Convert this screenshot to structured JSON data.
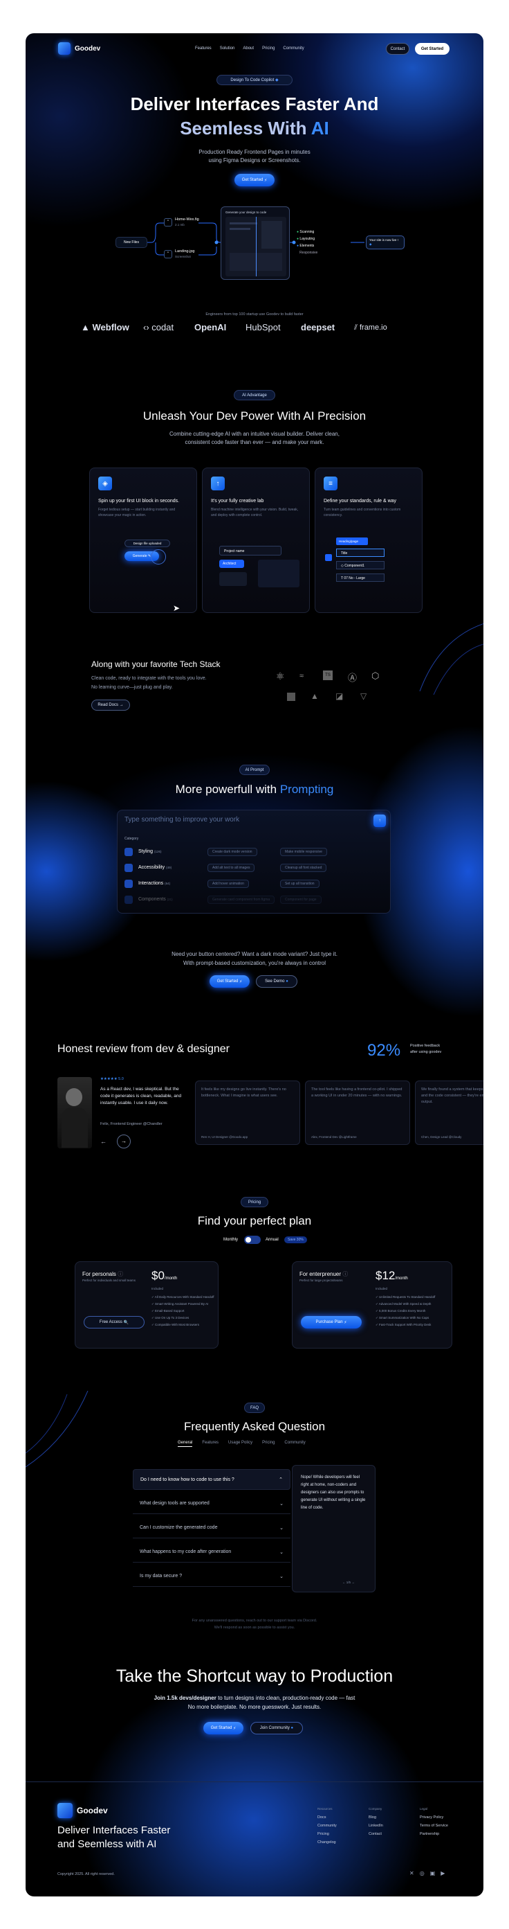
{
  "brand": {
    "name": "Goodev",
    "accent": "#1c62ff"
  },
  "nav": {
    "links": [
      "Features",
      "Solution",
      "About",
      "Pricing",
      "Community"
    ],
    "contact": "Contact",
    "get_started": "Get Started"
  },
  "hero": {
    "badge": "Design To Code Copilot",
    "title_line1": "Deliver Interfaces Faster And",
    "title_line2a": "Seemless With ",
    "title_line2b": "AI",
    "subtitle_line1": "Production Ready Frontend Pages in minutes",
    "subtitle_line2": "using Figma Designs or Screenshots.",
    "cta": "Get Started"
  },
  "flow": {
    "new_files": "New Files",
    "file1": "Home-Wex.fig",
    "file1_size": "2.1 mb",
    "file2": "Landing.jpg",
    "file2_size": "Screenshot",
    "generate": "Generate your design to code",
    "steps": [
      "Scanning",
      "Layouting",
      "Elements",
      "Responsive"
    ],
    "ready": "Your site is now live !"
  },
  "trusted": {
    "caption": "Engineers from top 100 startup use Goodev to build faster",
    "logos": [
      "Webflow",
      "codat",
      "OpenAI",
      "HubSpot",
      "deepset",
      "frame.io"
    ]
  },
  "advantage": {
    "badge": "AI Advantage",
    "title": "Unleash Your Dev Power With AI Precision",
    "sub1": "Combine cutting-edge AI with an intuitive visual builder. Deliver clean,",
    "sub2": "consistent code faster than ever — and make your mark.",
    "cards": [
      {
        "title": "Spin up your first UI block in seconds.",
        "desc": "Forget tedious setup — start building instantly and showcase your magic in action.",
        "btn1": "Design file uploaded",
        "btn2": "Generate"
      },
      {
        "title": "It's your fully creative lab",
        "desc": "Blend machine intelligence with your vision. Build, tweak, and deploy with complete control.",
        "row1": "Project name",
        "row2": "Architect"
      },
      {
        "title": "Define your standards, rule & way",
        "desc": "Turn team guidelines and conventions into custom consistency.",
        "tag": "Heading/page",
        "item1": "Title",
        "item2": "Component1",
        "item3": "07 No - Large"
      }
    ]
  },
  "stack": {
    "title": "Along with your favorite Tech Stack",
    "desc1": "Clean code, ready to integrate with the tools you love.",
    "desc2": "No learning curve—just plug and play.",
    "cta": "Read Docs",
    "icons": [
      "react-icon",
      "tailwind-icon",
      "typescript-icon",
      "angular-icon",
      "css-icon",
      "next-icon",
      "vite-icon",
      "vue-icon",
      "nuxt-icon"
    ]
  },
  "prompting": {
    "badge": "AI Prompt",
    "title_a": "More  powerfull with ",
    "title_b": "Prompting",
    "placeholder": "Type something to improve your work",
    "category": "Category",
    "rows": [
      {
        "label": "Styling",
        "count": "(126)",
        "c1": "Create dark mode version",
        "c2": "Make mobile responsive"
      },
      {
        "label": "Accessibility",
        "count": "(49)",
        "c1": "Add alt text to all images",
        "c2": "Cleanup all font stacked"
      },
      {
        "label": "Interactions",
        "count": "(64)",
        "c1": "Add hover animation",
        "c2": "Set up all transition"
      },
      {
        "label": "Components",
        "count": "(21)",
        "c1": "Generate card component from figma",
        "c2": "Component for page"
      }
    ],
    "sub1": "Need your button centered? Want a dark mode variant? Just type it.",
    "sub2": "With prompt-based customization, you're always in control",
    "cta1": "Get Started",
    "cta2": "See Demo"
  },
  "reviews": {
    "title": "Honest review from dev & ",
    "title_b": "designer",
    "stat": "92%",
    "stat_label1": "Positive feedback",
    "stat_label2": "after using goodev",
    "stars": "★★★★★ 5.0",
    "main": {
      "text": "As a React dev, I was skeptical. But the code it generates is clean, readable, and instantly usable. I use it daily now.",
      "author": "Felix, Frontend Engineer @Chandler"
    },
    "items": [
      {
        "text": "It feels like my designs go live instantly. There's no bottleneck. What I imagine is what users see.",
        "author": "Ren H, UI Designer @Goodo.app"
      },
      {
        "text": "The tool feels like having a frontend co-pilot. I shipped a working UI in under 20 minutes — with no warnings.",
        "author": "Alex, Frontend Dev @Lightframe"
      },
      {
        "text": "We finally found a system that keeps design guidelines and the code consistent — they're embedded in every output.",
        "author": "Chen, Design Lead @Cloudy"
      }
    ]
  },
  "pricing": {
    "badge": "Pricing",
    "title": "Find your perfect plan",
    "monthly": "Monthly",
    "annual": "Annual",
    "save": "Save 30%",
    "plans": [
      {
        "name": "For personals",
        "desc": "Perfect for individuals and small teams",
        "price": "$0",
        "per": "/month",
        "included": "Included",
        "features": [
          "All Daily Resources With Standard Handoff",
          "Smart Writing Assistant Powered By AI",
          "Email-Based Support",
          "Use On Up To 3 Devices",
          "Compatible With Most Browsers"
        ],
        "cta": "Free Access"
      },
      {
        "name": "For enterprenuer",
        "desc": "Perfect for large projects/teams",
        "price": "$12",
        "per": "/month",
        "included": "Included",
        "features": [
          "Unlimited Requests To Standard Handoff",
          "Advanced Model With Speed & Depth",
          "5,000 Bonus Credits Every Month",
          "Smart Summarization With No Caps",
          "Fast-Track Support With Priority Desk"
        ],
        "cta": "Purchase Plan"
      }
    ]
  },
  "faq": {
    "badge": "FAQ",
    "title": "Frequently Asked Question",
    "tabs": [
      "General",
      "Features",
      "Usage Policy",
      "Pricing",
      "Community"
    ],
    "questions": [
      "Do I need to know how to code to use this ?",
      "What design tools are supported",
      "Can I customize the generated code",
      "What happens to my code after generation",
      "Is my data secure ?"
    ],
    "answer": "Nope! While developers will feel right at home, non-coders and designers can also use prompts to generate UI without writing a single line of code.",
    "page": "1/5",
    "foot1": "For any unanswered questions, reach out to our support team via Discord.",
    "foot2": "We'll respond as soon as possible to assist you."
  },
  "shortcut": {
    "title": "Take the Shortcut way to Production",
    "line1_bold": "Join 1.5k devs/designer",
    "line1_rest": " to turn designs into clean, production-ready code — fast",
    "line2": "No more boilerplate. No more guesswork. Just results.",
    "cta1": "Get Started",
    "cta2": "Join Community"
  },
  "footer": {
    "brand": "Goodev",
    "tag1": "Deliver Interfaces Faster",
    "tag2": "and Seemless with AI",
    "cols": [
      {
        "title": "Resources",
        "links": [
          "Docs",
          "Community",
          "Pricing",
          "Changelog"
        ]
      },
      {
        "title": "Company",
        "links": [
          "Blog",
          "LinkedIn",
          "Contact"
        ]
      },
      {
        "title": "Legal",
        "links": [
          "Privacy Policy",
          "Terms of Service",
          "Partnership"
        ]
      }
    ],
    "copyright": "Copyright 2025. All right reserved."
  }
}
